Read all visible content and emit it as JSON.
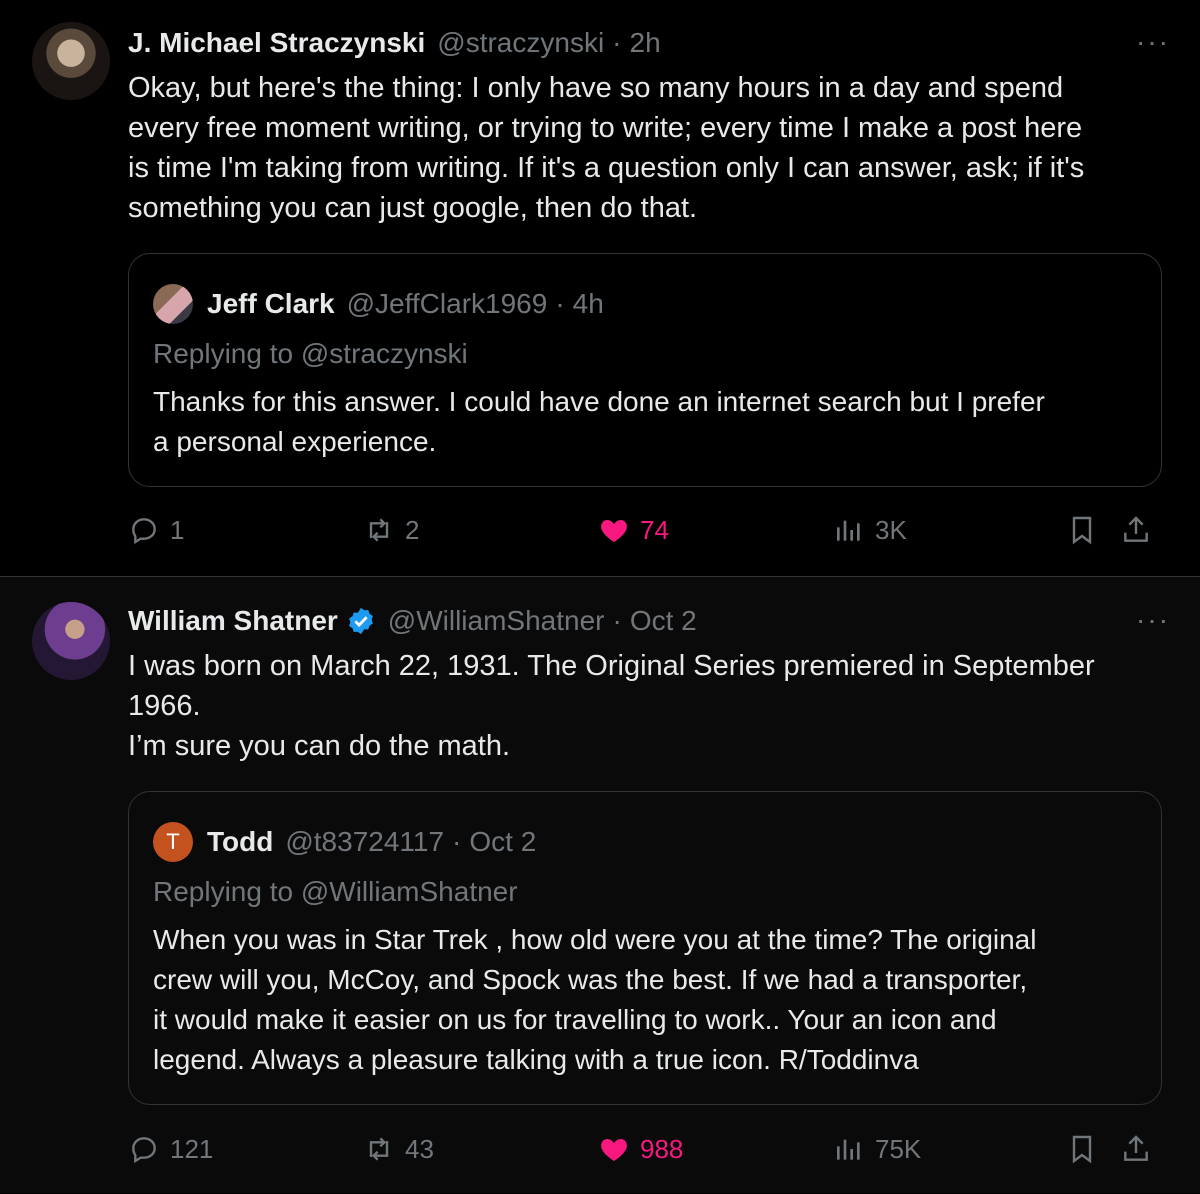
{
  "tweets": [
    {
      "author_name": "J. Michael Straczynski",
      "author_handle": "@straczynski",
      "separator": "·",
      "time": "2h",
      "more": "···",
      "text": "Okay, but here's the thing: I only have so many hours in a day and spend\nevery free moment writing, or trying to write; every time I make a post here\nis time I'm taking from writing. If it's a question only I can answer, ask; if it's\nsomething you can just google, then do that.",
      "quote": {
        "author_name": "Jeff Clark",
        "author_handle": "@JeffClark1969",
        "separator": "·",
        "time": "4h",
        "replying_to": "Replying to @straczynski",
        "text": "Thanks for this answer. I could have done an internet search but I prefer\na personal experience."
      },
      "stats": {
        "replies": "1",
        "reposts": "2",
        "likes": "74",
        "views": "3K"
      }
    },
    {
      "author_name": "William Shatner",
      "author_handle": "@WilliamShatner",
      "separator": "·",
      "time": "Oct 2",
      "more": "···",
      "text": "I was born on March 22, 1931. The Original Series premiered in September\n1966.\nI’m sure you can do the math.",
      "quote": {
        "avatar_letter": "T",
        "author_name": "Todd",
        "author_handle": "@t83724117",
        "separator": "·",
        "time": "Oct 2",
        "replying_to": "Replying to @WilliamShatner",
        "text": "When you was in Star Trek , how old were you at the time?  The original\ncrew will you, McCoy, and Spock was the best. If we had a transporter,\nit would make it easier on us for travelling to work.. Your an icon and\nlegend. Always a pleasure talking with a true icon. R/Toddinva"
      },
      "stats": {
        "replies": "121",
        "reposts": "43",
        "likes": "988",
        "views": "75K"
      }
    }
  ],
  "colors": {
    "background": "#000000",
    "text": "#e7e9ea",
    "muted": "#71767b",
    "like": "#f91880",
    "verified": "#1d9bf0",
    "border": "#2f3336"
  }
}
